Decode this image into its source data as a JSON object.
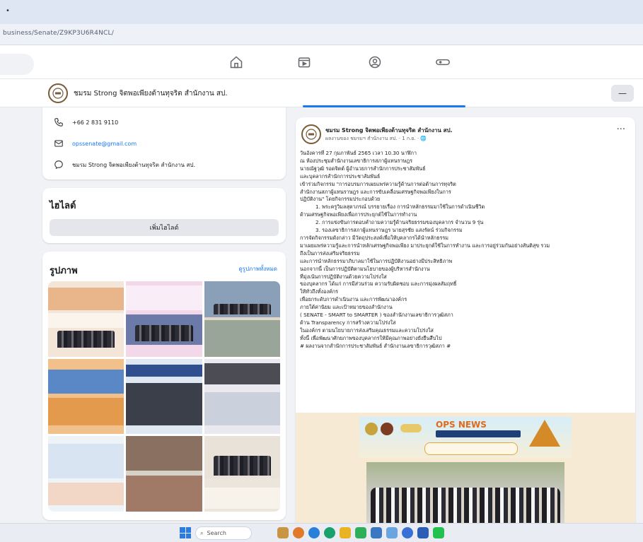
{
  "browser": {
    "address_text": "business/Senate/Z9KP3U6R4NCL/"
  },
  "page": {
    "name": "ชมรม Strong จิตพอเพียงต้านทุจริต สำนักงาน สป."
  },
  "contact": {
    "phone": "+66 2 831 9110",
    "email": "opssenate@gmail.com",
    "messenger": "ชมรม Strong จิตพอเพียงต้านทุจริต สำนักงาน สป."
  },
  "featured": {
    "title": "ไฮไลต์",
    "add_button": "เพิ่มไฮไลต์"
  },
  "photos": {
    "title": "รูปภาพ",
    "see_all": "ดูรูปภาพทั้งหมด"
  },
  "post": {
    "author": "ชมรม Strong จิตพอเพียงต้านทุจริต สำนักงาน สป.",
    "meta": "ผลงานของ ชมรมฯ สำนักงาน สป. · 1 ก.ย. · 🌐",
    "menu": "···",
    "lines": [
      "วันอังคารที่ 27 กุมภาพันธ์ 2565 เวลา 10.30 นาฬิกา",
      "ณ ห้องประชุมสำนักงานเลขาธิการสภาผู้แทนราษฎร",
      "นายณัฐวุฒิ รอดจิตต์ ผู้อำนวยการสำนักการประชาสัมพันธ์",
      "และบุคลากรสำนักการประชาสัมพันธ์",
      "เข้าร่วมกิจกรรม \"การอบรมการเผยแพร่ความรู้ด้านการต่อต้านการทุจริต",
      "สำนักงานสภาผู้แทนราษฎร และการขับเคลื่อนเศรษฐกิจพอเพียงในการ",
      "ปฏิบัติงาน\" โดยกิจกรรมประกอบด้วย",
      "1. พระครูวิมลสุตาภรณ์ บรรยายเรื่อง การนำหลักธรรมมาใช้ในการดำเนินชีวิต",
      "ด้านเศรษฐกิจพอเพียงเพื่อการประยุกต์ใช้ในการทำงาน",
      "2. การแข่งขันการตอบคำถามความรู้ด้านจริยธรรมของบุคลากร จำนวน 9 รุ่น",
      "3. รองเลขาธิการสภาผู้แทนราษฎร นายสุรชัย แสงรัตน์ ร่วมกิจกรรม",
      "การจัดกิจกรรมดังกล่าว มีวัตถุประสงค์เพื่อให้บุคลากรได้นำหลักธรรม",
      "มาเผยแพร่ความรู้และการนำหลักเศรษฐกิจพอเพียง มาประยุกต์ใช้ในการทำงาน และการอยู่ร่วมกันอย่างสันติสุข รวม",
      "ถึงเป็นการส่งเสริมจริยธรรม",
      "และการนำหลักธรรมาภิบาลมาใช้ในการปฏิบัติงานอย่างมีประสิทธิภาพ",
      "นอกจากนี้ เป็นการปฏิบัติตามนโยบายของผู้บริหารสำนักงาน",
      "ที่มุ่งเน้นการปฏิบัติงานด้วยความโปร่งใส",
      "ของบุคลากร ได้แก่ การมีส่วนร่วม ความรับผิดชอบ และการมุ่งผลสัมฤทธิ์",
      "ให้ทั่วถึงทั้งองค์กร",
      "เพื่อยกระดับการดำเนินงาน และการพัฒนาองค์กร",
      "ภายใต้ค่านิยม และเป้าหมายของสำนักงาน",
      "( SENATE - SMART to SMARTER ) ของสำนักงานเลขาธิการวุฒิสภา",
      "ด้าน Transparency การสร้างความโปร่งใส",
      "ในองค์กร ตามนโยบายการส่งเสริมคุณธรรมและความโปร่งใส",
      "ทั้งนี้ เพื่อพัฒนาศักยภาพของบุคลากรให้มีคุณภาพอย่างยั่งยืนสืบไป",
      "# ผลงานจากสำนักการประชาสัมพันธ์ สำนักงานเลขาธิการวุฒิสภา #"
    ],
    "banner_title": "OPS NEWS"
  },
  "taskbar": {
    "search_label": "Search"
  }
}
